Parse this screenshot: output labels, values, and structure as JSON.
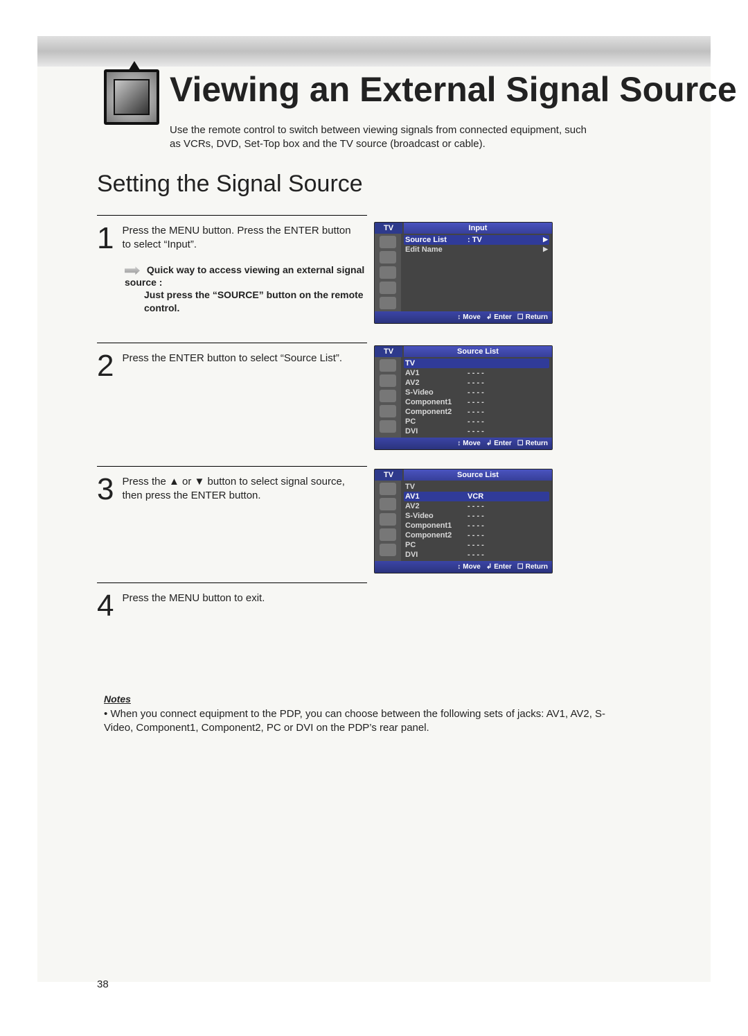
{
  "page_number": "38",
  "title": "Viewing an External Signal Source",
  "intro": "Use the remote control to switch between viewing signals from connected equipment, such as VCRs, DVD, Set-Top box and the TV source (broadcast or cable).",
  "subtitle": "Setting the Signal Source",
  "steps": {
    "1": {
      "num": "1",
      "text": "Press the MENU button. Press the ENTER button to select “Input”."
    },
    "2": {
      "num": "2",
      "text": "Press the ENTER button to select “Source List”."
    },
    "3": {
      "num": "3",
      "text": "Press the ▲ or ▼ button to select signal source, then press the ENTER button."
    },
    "4": {
      "num": "4",
      "text": "Press the MENU button to exit."
    }
  },
  "tip": {
    "line1": "Quick way to access viewing an external signal source :",
    "line2": "Just press the “SOURCE” button on the remote control."
  },
  "osd": {
    "tv_label": "TV",
    "foot_move": "Move",
    "foot_enter": "Enter",
    "foot_return": "Return",
    "screen1": {
      "title": "Input",
      "rows": [
        {
          "lbl": "Source List",
          "val": ":  TV",
          "arw": "▶",
          "sel": true
        },
        {
          "lbl": "Edit Name",
          "val": "",
          "arw": "▶",
          "sel": false
        }
      ]
    },
    "screen2": {
      "title": "Source List",
      "rows": [
        {
          "lbl": "TV",
          "val": "",
          "sel": true
        },
        {
          "lbl": "AV1",
          "val": "- - - -",
          "sel": false
        },
        {
          "lbl": "AV2",
          "val": "- - - -",
          "sel": false
        },
        {
          "lbl": "S-Video",
          "val": "- - - -",
          "sel": false
        },
        {
          "lbl": "Component1",
          "val": "- - - -",
          "sel": false
        },
        {
          "lbl": "Component2",
          "val": "- - - -",
          "sel": false
        },
        {
          "lbl": "PC",
          "val": "- - - -",
          "sel": false
        },
        {
          "lbl": "DVI",
          "val": "- - - -",
          "sel": false
        }
      ]
    },
    "screen3": {
      "title": "Source List",
      "rows": [
        {
          "lbl": "TV",
          "val": "",
          "sel": false
        },
        {
          "lbl": "AV1",
          "val": "VCR",
          "sel": true
        },
        {
          "lbl": "AV2",
          "val": "- - - -",
          "sel": false
        },
        {
          "lbl": "S-Video",
          "val": "- - - -",
          "sel": false
        },
        {
          "lbl": "Component1",
          "val": "- - - -",
          "sel": false
        },
        {
          "lbl": "Component2",
          "val": "- - - -",
          "sel": false
        },
        {
          "lbl": "PC",
          "val": "- - - -",
          "sel": false
        },
        {
          "lbl": "DVI",
          "val": "- - - -",
          "sel": false
        }
      ]
    }
  },
  "notes": {
    "heading": "Notes",
    "bullet": "•",
    "text": "When you connect equipment to the PDP, you can choose between the following sets of jacks: AV1, AV2, S-Video, Component1, Component2, PC or DVI on the PDP’s rear panel."
  }
}
